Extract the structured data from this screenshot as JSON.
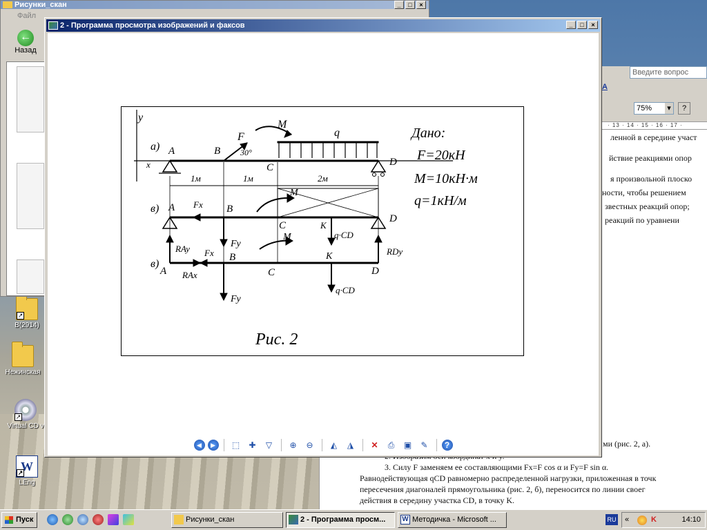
{
  "explorer": {
    "title": "Рисунки_скан",
    "menu_file": "Файл",
    "back_label": "Назад"
  },
  "desktop_icons": [
    {
      "label": "В(2914)"
    },
    {
      "label": "Нежинская"
    },
    {
      "label": "Virtual CD v"
    },
    {
      "label": "LEng"
    }
  ],
  "viewer": {
    "title": "2 - Программа просмотра изображений и факсов",
    "caption": "Рис. 2",
    "toolbar": [
      {
        "name": "previous-image-icon",
        "glyph": "◀"
      },
      {
        "name": "next-image-icon",
        "glyph": "▶"
      },
      {
        "name": "best-fit-icon",
        "glyph": "⬚"
      },
      {
        "name": "actual-size-icon",
        "glyph": "✚"
      },
      {
        "name": "slideshow-icon",
        "glyph": "▽"
      },
      {
        "name": "zoom-in-icon",
        "glyph": "⊕"
      },
      {
        "name": "zoom-out-icon",
        "glyph": "⊖"
      },
      {
        "name": "rotate-clockwise-icon",
        "glyph": "◭"
      },
      {
        "name": "rotate-counterclockwise-icon",
        "glyph": "◮"
      },
      {
        "name": "delete-icon",
        "glyph": "✕"
      },
      {
        "name": "print-icon",
        "glyph": "⎙"
      },
      {
        "name": "save-icon",
        "glyph": "▣"
      },
      {
        "name": "edit-icon",
        "glyph": "✎"
      },
      {
        "name": "help-icon",
        "glyph": "?"
      }
    ]
  },
  "figure": {
    "label_a": "а)",
    "label_b": "в)",
    "label_v": "в)",
    "y_axis": "y",
    "x_axis": "x",
    "point_A": "A",
    "point_B": "B",
    "point_C": "C",
    "point_D": "D",
    "point_K": "K",
    "force_F": "F",
    "angle": "30°",
    "moment_M": "M",
    "load_q": "q",
    "dim_1": "1м",
    "dim_2": "1м",
    "dim_3": "2м",
    "given_title": "Дано:",
    "given_F": "F=20кН",
    "given_M": "M=10кН·м",
    "given_q": "q=1кН/м",
    "fx": "Fx",
    "fy": "Fy",
    "qcd": "q·CD",
    "rax": "RAx",
    "ray": "RAy",
    "rdy": "RDy"
  },
  "word": {
    "ask_placeholder": "Введите вопрос",
    "zoom": "75%",
    "ruler": "· 13 · 14 · 15 · 16 · 17 ·",
    "lines": [
      "ленной в середине участ",
      "йствие реакциями опор",
      "я произвольной плоско",
      "ности, чтобы решением",
      "звестных реакций опор;",
      " реакций по уравнени"
    ],
    "bottom_lines": [
      "ми (рис. 2, а).",
      "2. Изобразим оси координат x и y.",
      "3. Силу F заменяем ее составляющими Fx=F cos α и Fy=F sin α.",
      "Равнодействующая qCD равномерно распределенной нагрузки, приложенная в точк",
      "пересечения диагоналей прямоугольника (рис. 2, б), переносится по линии своег",
      "действия в середину участка CD, в точку K."
    ]
  },
  "taskbar": {
    "start": "Пуск",
    "tasks": [
      {
        "label": "Рисунки_скан"
      },
      {
        "label": "2 - Программа просм..."
      },
      {
        "label": "Методичка - Microsoft ..."
      }
    ],
    "lang": "RU",
    "clock": "14:10"
  }
}
